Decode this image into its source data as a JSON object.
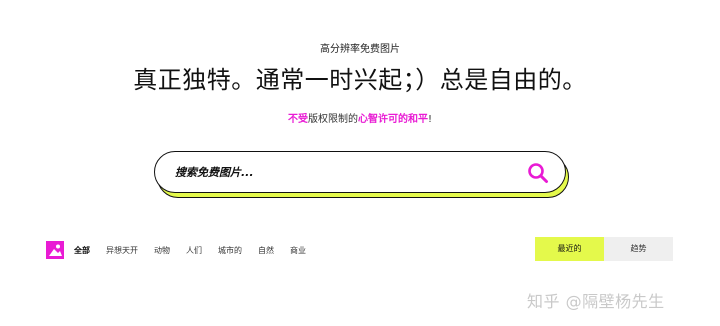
{
  "hero": {
    "subtitle": "高分辨率免费图片",
    "headline": "真正独特。通常一时兴起；）总是自由的。",
    "tagline_pink1": "不受",
    "tagline_mid": "版权限制的",
    "tagline_pink2": "心智许可的和平",
    "tagline_end": "!"
  },
  "search": {
    "placeholder": "搜索免费图片...",
    "value": "",
    "button_icon": "search-icon"
  },
  "categories": {
    "items": [
      "全部",
      "异想天开",
      "动物",
      "人们",
      "城市的",
      "自然",
      "商业"
    ],
    "active_index": 0
  },
  "sort": {
    "recent_label": "最近的",
    "trending_label": "趋势",
    "active": "recent"
  },
  "watermark": {
    "text": "知乎 @隔壁杨先生"
  },
  "colors": {
    "accent_pink": "#e91bd4",
    "accent_lime": "#e4f94b"
  }
}
